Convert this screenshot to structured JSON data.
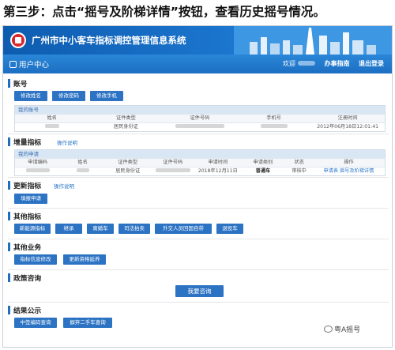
{
  "step_title": "第三步：点击“摇号及阶梯详情”按钮，查看历史摇号情况。",
  "header": {
    "system_title": "广州市中小客车指标调控管理信息系统",
    "nav_title": "用户中心",
    "nav_links": [
      "欢迎",
      "办事指南",
      "退出登录"
    ]
  },
  "account": {
    "title": "账号",
    "buttons": [
      "修改姓名",
      "修改密码",
      "修改手机"
    ],
    "table_caption": "我的账号",
    "columns": [
      "姓名",
      "证件类型",
      "证件号码",
      "手机号",
      "注册时间"
    ],
    "row": [
      "",
      "居民身份证",
      "",
      "",
      "2012年06月18日12:01:41"
    ]
  },
  "increment": {
    "title": "增量指标",
    "link": "操作说明",
    "table_caption": "我的申请",
    "columns": [
      "申请编码",
      "姓名",
      "证件类型",
      "证件号码",
      "申请时间",
      "申请类别",
      "状态",
      "操作"
    ],
    "row": [
      "",
      "",
      "居民身份证",
      "",
      "2018年12月11日",
      "普通车",
      "审核中",
      "申请表  摇号及阶梯详情"
    ]
  },
  "update": {
    "title": "更新指标",
    "link": "操作说明",
    "buttons": [
      "填报申请"
    ]
  },
  "other_index": {
    "title": "其他指标",
    "buttons": [
      "新能源指标",
      "继承",
      "离婚车",
      "司法拍卖",
      "外交人员回国自带",
      "退役车"
    ]
  },
  "other_business": {
    "title": "其他业务",
    "buttons": [
      "指标信息修改",
      "更新资格延养"
    ]
  },
  "policy": {
    "title": "政策咨询",
    "button": "我要咨询"
  },
  "results": {
    "title": "结果公示",
    "buttons": [
      "中签编码查询",
      "摒弃二手车查询"
    ]
  },
  "watermark": "粤A摇号"
}
